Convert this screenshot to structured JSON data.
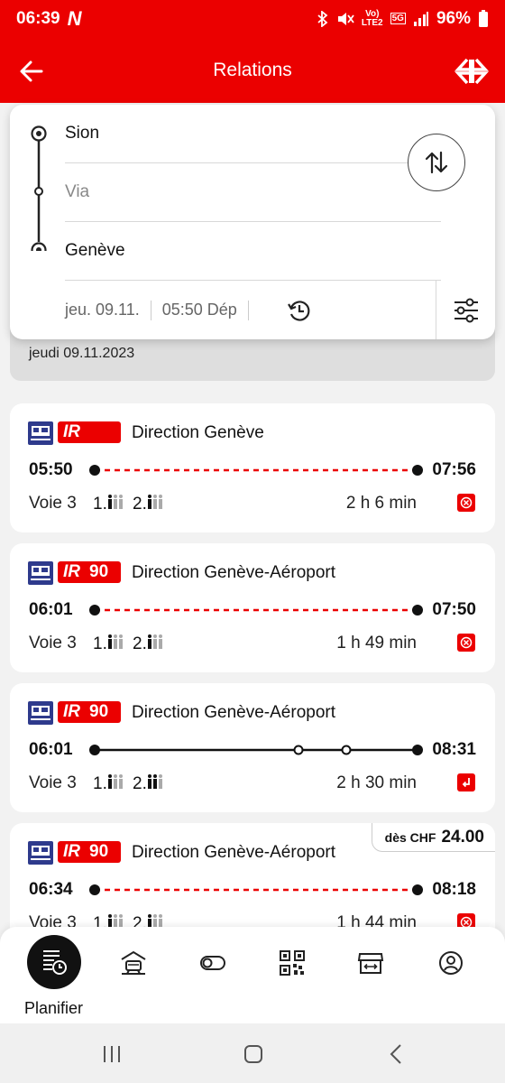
{
  "status_bar": {
    "time": "06:39",
    "carrier_logo": "N",
    "network_labels": [
      "Vo)",
      "LTE2",
      "5G"
    ],
    "battery": "96%"
  },
  "app_bar": {
    "title": "Relations",
    "back_icon": "arrow-left-icon",
    "logo_icon": "sbb-logo-icon"
  },
  "search": {
    "from": "Sion",
    "via_placeholder": "Via",
    "to": "Genève",
    "date": "jeu. 09.11.",
    "time": "05:50 Dép"
  },
  "date_header": "jeudi 09.11.2023",
  "connections": [
    {
      "product": "IR",
      "line": "",
      "direction": "Direction Genève",
      "departure": "05:50",
      "arrival": "07:56",
      "platform": "Voie 3",
      "class1": "1.",
      "class2": "2.",
      "duration": "2 h 6 min",
      "status": "cancelled",
      "stops": 0,
      "line_style": "dashed"
    },
    {
      "product": "IR",
      "line": "90",
      "direction": "Direction Genève-Aéroport",
      "departure": "06:01",
      "arrival": "07:50",
      "platform": "Voie 3",
      "class1": "1.",
      "class2": "2.",
      "duration": "1 h 49 min",
      "status": "cancelled",
      "stops": 0,
      "line_style": "dashed"
    },
    {
      "product": "IR",
      "line": "90",
      "direction": "Direction Genève-Aéroport",
      "departure": "06:01",
      "arrival": "08:31",
      "platform": "Voie 3",
      "class1": "1.",
      "class2": "2.",
      "duration": "2 h 30 min",
      "status": "alternative",
      "stops": 2,
      "line_style": "solid"
    },
    {
      "product": "IR",
      "line": "90",
      "direction": "Direction Genève-Aéroport",
      "departure": "06:34",
      "arrival": "08:18",
      "platform": "Voie 3",
      "class1": "1.",
      "class2": "2.",
      "duration": "1 h 44 min",
      "status": "cancelled",
      "stops": 0,
      "line_style": "dashed",
      "price_prefix": "dès CHF",
      "price": "24.00"
    }
  ],
  "tabs": [
    {
      "label": "Planifier",
      "icon": "timetable-clock-icon",
      "active": true
    },
    {
      "label": "",
      "icon": "train-station-icon"
    },
    {
      "label": "",
      "icon": "toggle-icon"
    },
    {
      "label": "",
      "icon": "qr-code-icon"
    },
    {
      "label": "",
      "icon": "shop-icon"
    },
    {
      "label": "",
      "icon": "user-profile-icon"
    }
  ],
  "colors": {
    "brand_red": "#eb0000",
    "dark": "#111111",
    "muted": "#888888",
    "background": "#f2f2f2"
  }
}
